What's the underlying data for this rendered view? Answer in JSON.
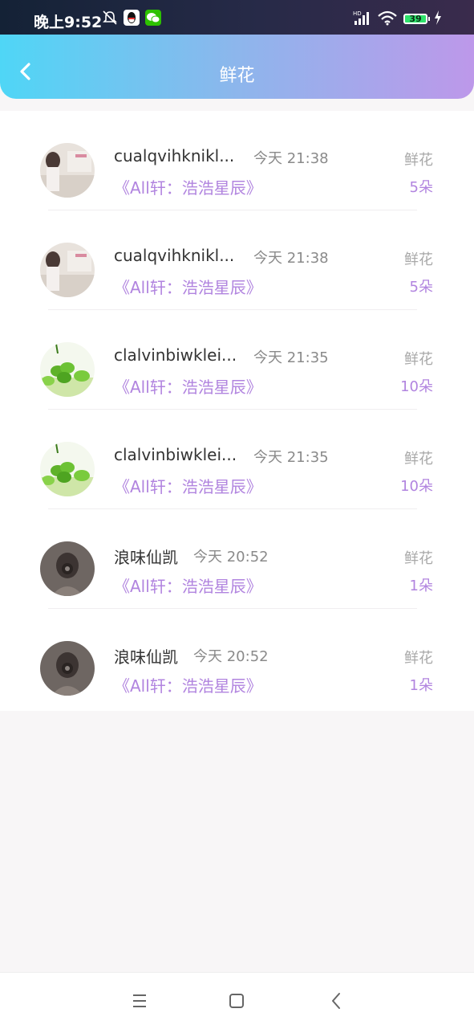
{
  "status": {
    "time": "晚上9:52",
    "battery": "39"
  },
  "header": {
    "title": "鲜花"
  },
  "records": [
    {
      "name": "cualqvihknikl...",
      "time": "今天 21:38",
      "song": "《All轩：浩浩星辰》",
      "gift": "鲜花",
      "count": "5朵",
      "avatar": "girl-photo"
    },
    {
      "name": "cualqvihknikl...",
      "time": "今天 21:38",
      "song": "《All轩：浩浩星辰》",
      "gift": "鲜花",
      "count": "5朵",
      "avatar": "girl-photo"
    },
    {
      "name": "clalvinbiwklei...",
      "time": "今天 21:35",
      "song": "《All轩：浩浩星辰》",
      "gift": "鲜花",
      "count": "10朵",
      "avatar": "clover-photo"
    },
    {
      "name": "clalvinbiwklei...",
      "time": "今天 21:35",
      "song": "《All轩：浩浩星辰》",
      "gift": "鲜花",
      "count": "10朵",
      "avatar": "clover-photo"
    },
    {
      "name": "浪味仙凯",
      "time": "今天 20:52",
      "song": "《All轩：浩浩星辰》",
      "gift": "鲜花",
      "count": "1朵",
      "avatar": "dark-portrait"
    },
    {
      "name": "浪味仙凯",
      "time": "今天 20:52",
      "song": "《All轩：浩浩星辰》",
      "gift": "鲜花",
      "count": "1朵",
      "avatar": "dark-portrait"
    }
  ],
  "colors": {
    "accent": "#b184df",
    "header_start": "#4fd6f6",
    "header_end": "#bd98ea"
  }
}
